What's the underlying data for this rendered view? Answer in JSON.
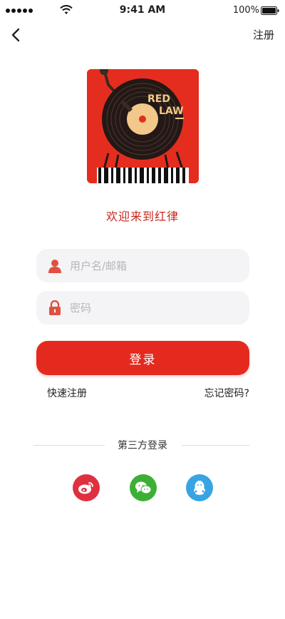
{
  "status_bar": {
    "time": "9:41 AM",
    "battery_percent": "100%"
  },
  "header": {
    "back_icon": "chevron-left-icon",
    "register_label": "注册"
  },
  "logo": {
    "text_line1": "RED",
    "text_line2": "LAW"
  },
  "welcome_text": "欢迎来到红律",
  "form": {
    "username_placeholder": "用户名/邮箱",
    "username_icon": "user-icon",
    "password_placeholder": "密码",
    "password_icon": "lock-icon",
    "login_label": "登录"
  },
  "links": {
    "quick_register": "快速注册",
    "forgot_password": "忘记密码?"
  },
  "third_party": {
    "title": "第三方登录",
    "providers": [
      {
        "name": "weibo",
        "icon": "weibo-icon",
        "color": "#e03040"
      },
      {
        "name": "wechat",
        "icon": "wechat-icon",
        "color": "#3cb034"
      },
      {
        "name": "qq",
        "icon": "qq-icon",
        "color": "#38a4e4"
      }
    ]
  },
  "colors": {
    "accent": "#e42a1f",
    "input_bg": "#f4f4f6"
  }
}
